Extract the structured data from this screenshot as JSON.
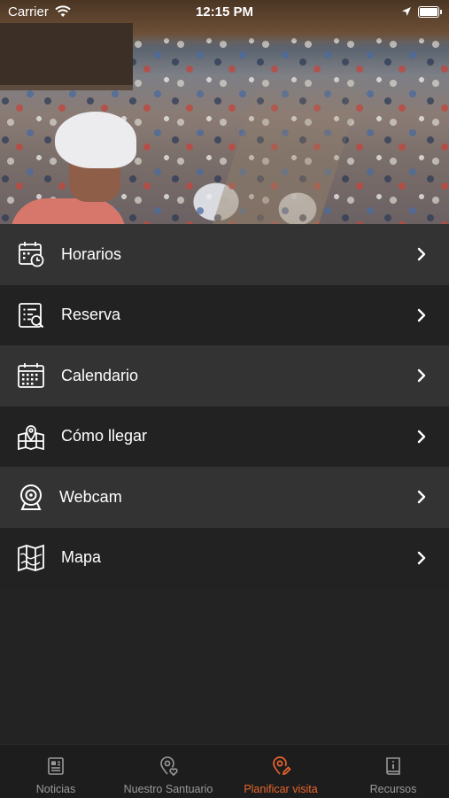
{
  "status_bar": {
    "carrier": "Carrier",
    "time": "12:15 PM"
  },
  "hero": {
    "description_icon": "crowd-photo"
  },
  "menu": {
    "items": [
      {
        "label": "Horarios",
        "icon": "schedule-calendar-clock-icon"
      },
      {
        "label": "Reserva",
        "icon": "reservation-document-search-icon"
      },
      {
        "label": "Calendario",
        "icon": "calendar-icon"
      },
      {
        "label": "Cómo llegar",
        "icon": "map-location-pin-icon"
      },
      {
        "label": "Webcam",
        "icon": "webcam-icon"
      },
      {
        "label": "Mapa",
        "icon": "folded-map-icon"
      }
    ]
  },
  "tab_bar": {
    "tabs": [
      {
        "label": "Noticias",
        "icon": "newspaper-icon",
        "active": false
      },
      {
        "label": "Nuestro Santuario",
        "icon": "location-heart-icon",
        "active": false
      },
      {
        "label": "Planificar visita",
        "icon": "location-pin-edit-icon",
        "active": true
      },
      {
        "label": "Recursos",
        "icon": "info-book-icon",
        "active": false
      }
    ]
  },
  "colors": {
    "accent": "#e8652e",
    "background": "#232323",
    "row_light": "#333333",
    "row_dark": "#222222",
    "tab_inactive": "#9a9a9a"
  }
}
